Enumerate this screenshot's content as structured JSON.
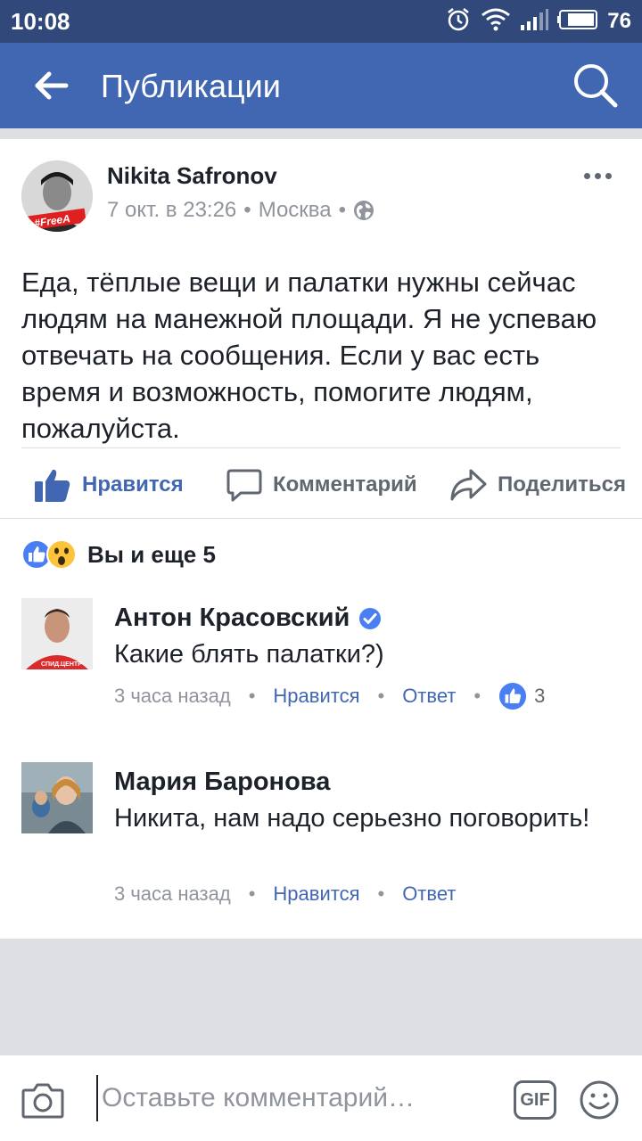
{
  "status_bar": {
    "time": "10:08",
    "battery": "76"
  },
  "app_bar": {
    "title": "Публикации"
  },
  "post": {
    "author": "Nikita Safronov",
    "date": "7 окт. в 23:26",
    "location": "Москва",
    "avatar_badge": "#FreeA",
    "text": "Еда, тёплые вещи и палатки нужны сейчас людям на манежной площади. Я не успеваю отвечать на сообщения. Если у вас есть время и возможность, помогите людям, пожалуйста."
  },
  "actions": {
    "like": "Нравится",
    "comment": "Комментарий",
    "share": "Поделиться"
  },
  "reactions": {
    "summary": "Вы и еще 5"
  },
  "comments": [
    {
      "name": "Антон Красовский",
      "verified": true,
      "text": "Какие блять палатки?)",
      "time": "3 часа назад",
      "like": "Нравится",
      "reply": "Ответ",
      "likes_count": "3",
      "avatar_badge": "СПИД.ЦЕНТР"
    },
    {
      "name": "Мария Баронова",
      "verified": false,
      "text": "Никита, нам надо серьезно поговорить!",
      "time": "3 часа назад",
      "like": "Нравится",
      "reply": "Ответ"
    }
  ],
  "composer": {
    "placeholder": "Оставьте комментарий…",
    "gif_label": "GIF"
  },
  "colors": {
    "brand": "#4267b2",
    "status_bar": "#30487a",
    "muted": "#90949c",
    "separator": "#dddfe2"
  }
}
